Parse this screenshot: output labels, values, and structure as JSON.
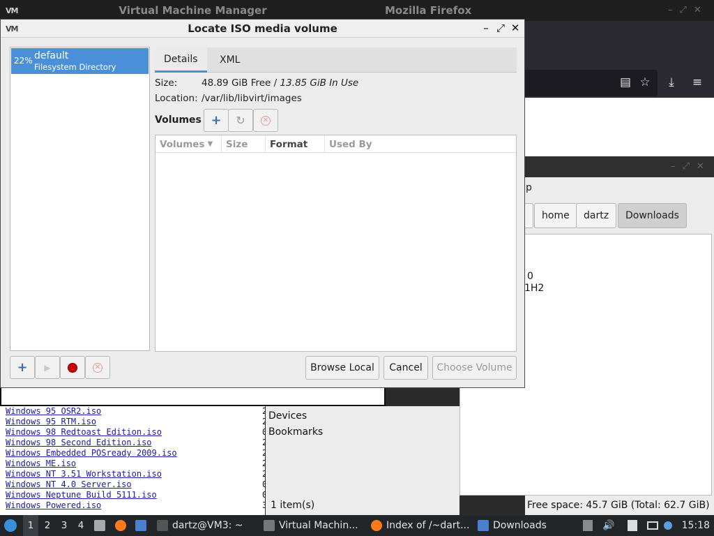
{
  "background": {
    "vmm_title": "Virtual Machine Manager",
    "firefox_title": "Mozilla Firefox",
    "file_manager": {
      "path": [
        "home",
        "dartz",
        "Downloads"
      ],
      "fragments": [
        "p",
        "0",
        "1H2"
      ],
      "places": [
        "Devices",
        "Bookmarks"
      ],
      "status_items": "1 item(s)",
      "status_free": "Free space: 45.7 GiB (Total: 62.7 GiB)"
    },
    "web_listing": [
      {
        "name": "Windows 95 OSR2.iso",
        "n": "2"
      },
      {
        "name": "Windows 95 RTM.iso",
        "n": "2"
      },
      {
        "name": "Windows 98 Redtoast Edition.iso",
        "n": "0"
      },
      {
        "name": "Windows 98 Second Edition.iso",
        "n": "2"
      },
      {
        "name": "Windows Embedded POSready 2009.iso",
        "n": "2"
      },
      {
        "name": "Windows ME.iso",
        "n": "2"
      },
      {
        "name": "Windows NT 3.51 Workstation.iso",
        "n": "2"
      },
      {
        "name": "Windows NT 4.0 Server.iso",
        "n": "0"
      },
      {
        "name": "Windows Neptune Build 5111.iso",
        "n": "0"
      },
      {
        "name": "Windows Powered.iso",
        "n": "3"
      }
    ]
  },
  "dialog": {
    "title": "Locate ISO media volume",
    "pool": {
      "percent": "22%",
      "name": "default",
      "type": "Filesystem Directory"
    },
    "tabs": {
      "details": "Details",
      "xml": "XML"
    },
    "size_label": "Size:",
    "size_free": "48.89 GiB Free / ",
    "size_inuse": "13.85 GiB In Use",
    "location_label": "Location:",
    "location_value": "/var/lib/libvirt/images",
    "volumes_label": "Volumes",
    "columns": {
      "volumes": "Volumes",
      "size": "Size",
      "format": "Format",
      "used_by": "Used By"
    },
    "buttons": {
      "browse_local": "Browse Local",
      "cancel": "Cancel",
      "choose_volume": "Choose Volume"
    }
  },
  "taskbar": {
    "workspaces": [
      "1",
      "2",
      "3",
      "4"
    ],
    "tasks": {
      "terminal": "dartz@VM3: ~",
      "vmm": "Virtual Machin...",
      "firefox": "Index of /~dart...",
      "files": "Downloads"
    },
    "clock": "15:18"
  },
  "colors": {
    "accent": "#4a90d9",
    "stop_red": "#cc0000",
    "link": "#1a1aa6"
  }
}
